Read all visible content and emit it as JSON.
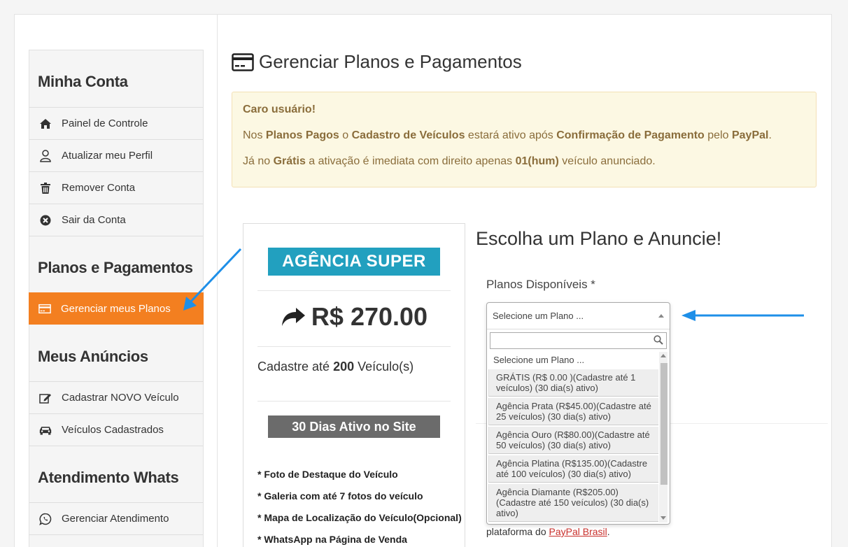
{
  "sidebar": {
    "sections": [
      {
        "title": "Minha Conta",
        "items": [
          {
            "label": "Painel de Controle",
            "icon": "home-icon"
          },
          {
            "label": "Atualizar meu Perfil",
            "icon": "user-icon"
          },
          {
            "label": "Remover Conta",
            "icon": "trash-icon"
          },
          {
            "label": "Sair da Conta",
            "icon": "close-circle-icon"
          }
        ]
      },
      {
        "title": "Planos e Pagamentos",
        "items": [
          {
            "label": "Gerenciar meus Planos",
            "icon": "credit-card-icon",
            "active": true
          }
        ]
      },
      {
        "title": "Meus Anúncios",
        "items": [
          {
            "label": "Cadastrar NOVO Veículo",
            "icon": "edit-icon"
          },
          {
            "label": "Veículos Cadastrados",
            "icon": "car-icon"
          }
        ]
      },
      {
        "title": "Atendimento Whats",
        "items": [
          {
            "label": "Gerenciar Atendimento",
            "icon": "whatsapp-icon"
          }
        ]
      }
    ],
    "active_color": "#f37f20"
  },
  "main": {
    "title": "Gerenciar Planos e Pagamentos",
    "alert": {
      "heading": "Caro usuário!",
      "line1": {
        "t1": "Nos ",
        "b1": "Planos Pagos",
        "t2": " o ",
        "b2": "Cadastro de Veículos",
        "t3": " estará ativo após ",
        "b3": "Confirmação de Pagamento",
        "t4": " pelo ",
        "b4": "PayPal",
        "t5": "."
      },
      "line2": {
        "t1": "Já no ",
        "b1": "Grátis",
        "t2": " a ativação é imediata com direito apenas ",
        "b2": "01(hum)",
        "t3": " veículo anunciado."
      }
    },
    "plan_card": {
      "name": "AGÊNCIA SUPER",
      "price": "R$ 270.00",
      "limit_prefix": "Cadastre até ",
      "limit_value": "200",
      "limit_suffix": " Veículo(s)",
      "days": "30 Dias Ativo no Site",
      "features": [
        "* Foto de Destaque do Veículo",
        "* Galeria com até 7 fotos do veículo",
        "* Mapa de Localização do Veículo(Opcional)",
        "* WhatsApp na Página de Venda"
      ],
      "name_color": "#22a0bf",
      "days_color": "#6b6b6b"
    },
    "choose_title": "Escolha um Plano e Anuncie!",
    "form_label": "Planos Disponíveis *",
    "select": {
      "selected": "Selecione um Plano ...",
      "search_value": "",
      "options": [
        "Selecione um Plano ...",
        "GRÁTIS (R$ 0.00 )(Cadastre até 1 veículos) (30 dia(s) ativo)",
        "Agência Prata (R$45.00)(Cadastre até 25 veículos) (30 dia(s) ativo)",
        "Agência Ouro (R$80.00)(Cadastre até 50 veículos) (30 dia(s) ativo)",
        "Agência Platina (R$135.00)(Cadastre até 100 veículos) (30 dia(s) ativo)",
        "Agência Diamante (R$205.00)(Cadastre até 150 veículos) (30 dia(s) ativo)"
      ]
    },
    "paypal": {
      "prefix": "plataforma do ",
      "link": "PayPal Brasil",
      "suffix": "."
    }
  },
  "annotation_color": "#1e8fe8"
}
